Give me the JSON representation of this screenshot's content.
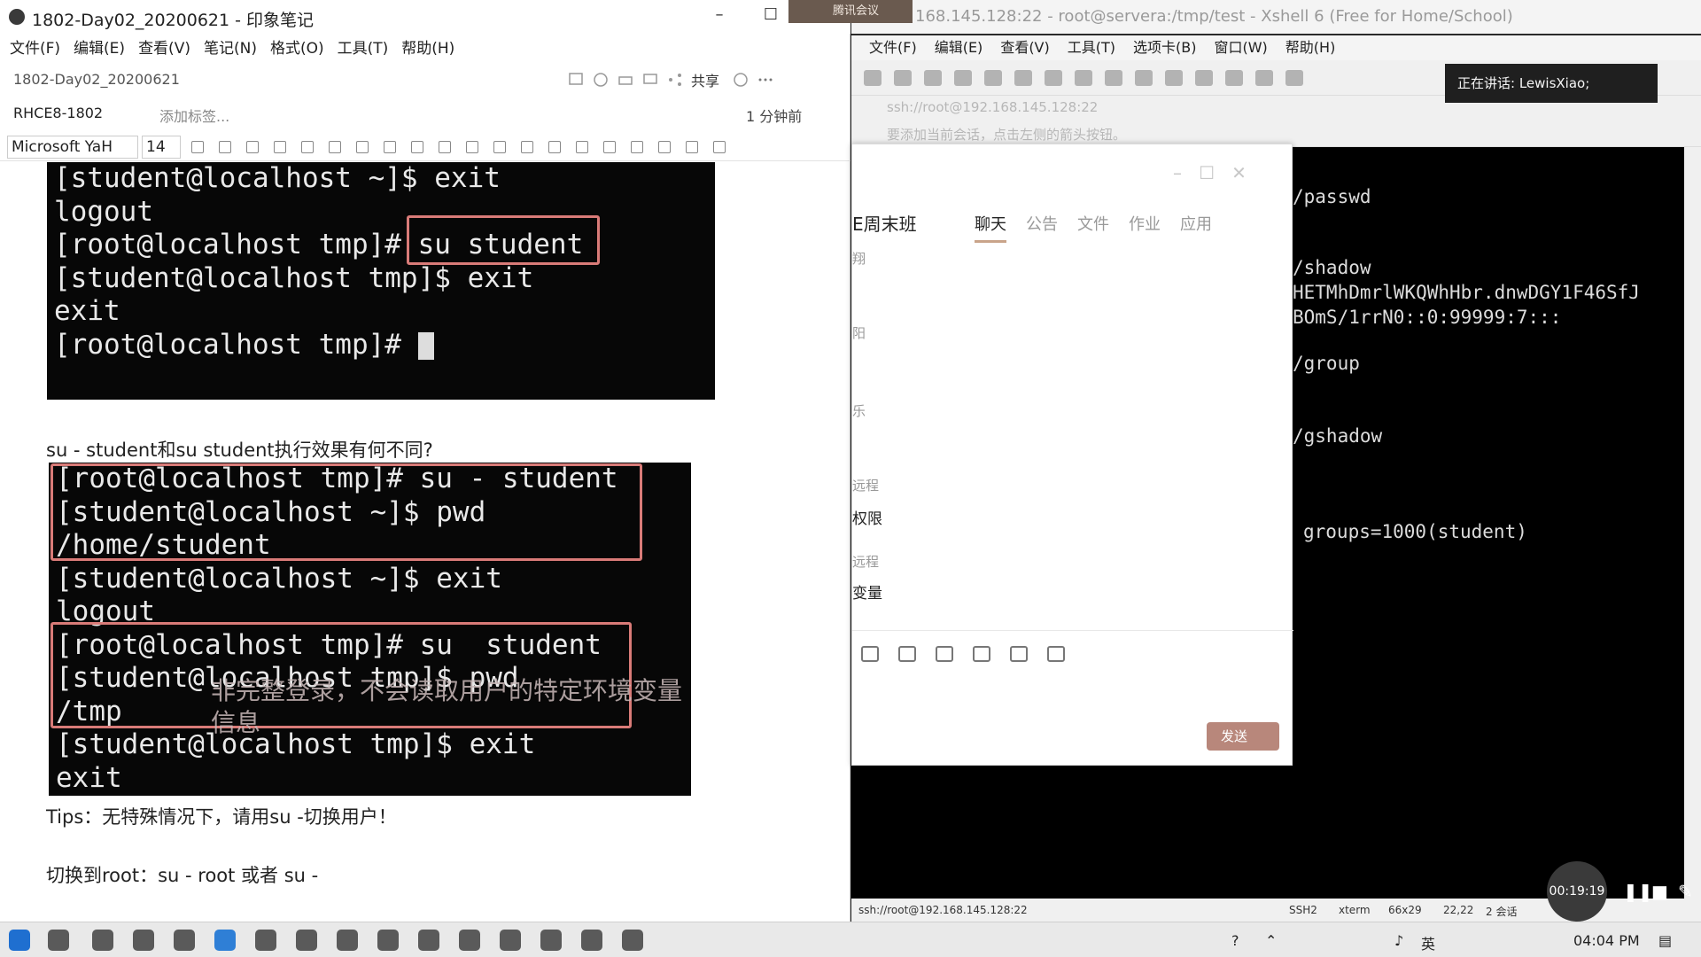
{
  "evernote": {
    "window_title": "1802-Day02_20200621 - 印象笔记",
    "menu": [
      "文件(F)",
      "编辑(E)",
      "查看(V)",
      "笔记(N)",
      "格式(O)",
      "工具(T)",
      "帮助(H)"
    ],
    "note_title": "1802-Day02_20200621",
    "share_label": "共享",
    "notebook": "RHCE8-1802",
    "add_tag": "添加标签...",
    "modified": "1 分钟前",
    "font_family": "Microsoft YaH",
    "font_size": "14",
    "term1": [
      "[student@localhost ~]$ exit",
      "logout",
      "[root@localhost tmp]# su student",
      "[student@localhost tmp]$ exit",
      "exit",
      "[root@localhost tmp]# "
    ],
    "question": "su - student和su student执行效果有何不同?",
    "term2": [
      "[root@localhost tmp]# su - student",
      "[student@localhost ~]$ pwd",
      "/home/student",
      "[student@localhost ~]$ exit",
      "logout",
      "[root@localhost tmp]# su  student",
      "[student@localhost tmp]$ pwd",
      "/tmp",
      "[student@localhost tmp]$ exit",
      "exit"
    ],
    "annotation": "非完整登录，不会读取用户的特定环境变量信息",
    "tips": "Tips：无特殊情况下，请用su -切换用户！",
    "switch_root": "切换到root：su - root 或者 su -"
  },
  "xshell": {
    "window_title": "168.145.128:22 - root@servera:/tmp/test - Xshell 6 (Free for Home/School)",
    "meeting_tab": "腾讯会议",
    "menu": [
      "文件(F)",
      "编辑(E)",
      "查看(V)",
      "工具(T)",
      "选项卡(B)",
      "窗口(W)",
      "帮助(H)"
    ],
    "speaking": "正在讲话: LewisXiao;",
    "address": "ssh://root@192.168.145.128:22",
    "hint": "要添加当前会话，点击左侧的箭头按钮。",
    "terminal_lines": [
      "/passwd",
      "/shadow",
      "HETMhDmrlWKQWhHbr.dnwDGY1F46SfJ",
      "BOmS/1rrN0::0:99999:7:::",
      "/group",
      "/gshadow",
      "groups=1000(student)"
    ],
    "status": {
      "conn": "ssh://root@192.168.145.128:22",
      "proto": "SSH2",
      "term": "xterm",
      "size": "66x29",
      "pos": "22,22",
      "sessions": "2 会话"
    }
  },
  "chat": {
    "group": "E周末班",
    "tabs": [
      "聊天",
      "公告",
      "文件",
      "作业",
      "应用"
    ],
    "side": [
      "翔",
      "阳",
      "乐",
      "远程",
      "权限",
      "远程",
      "变量"
    ],
    "send": "发送"
  },
  "recording": {
    "timer": "00:19:19"
  },
  "taskbar": {
    "ime": "英",
    "time": "04:04 PM"
  }
}
